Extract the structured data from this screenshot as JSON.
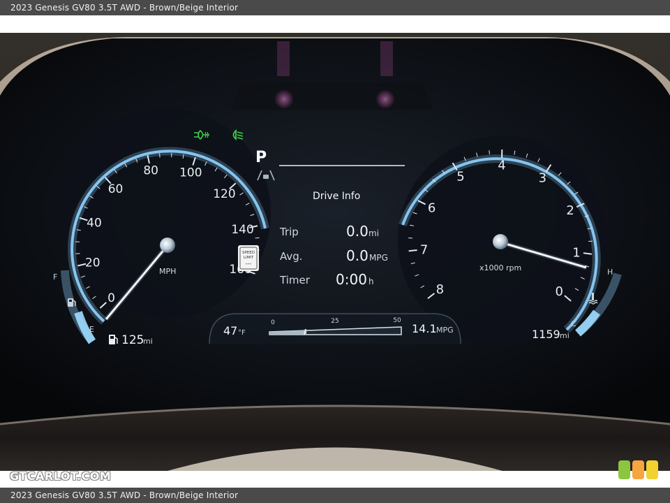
{
  "caption": "2023 Genesis GV80 3.5T AWD - Brown/Beige Interior",
  "watermark": "GTCARLOT.COM",
  "speedometer": {
    "ticks": [
      "0",
      "20",
      "40",
      "60",
      "80",
      "100",
      "120",
      "140",
      "160"
    ],
    "unit": "MPH",
    "range_value": "125",
    "range_unit": "mi",
    "fuel_full": "F",
    "fuel_empty": "E"
  },
  "tachometer": {
    "ticks": [
      "0",
      "1",
      "2",
      "3",
      "4",
      "5",
      "6",
      "7",
      "8"
    ],
    "unit": "x1000 rpm",
    "odometer_value": "1159",
    "odometer_unit": "mi",
    "temp_hot": "H",
    "temp_cold": "C"
  },
  "gear": "P",
  "drive_info": {
    "title": "Drive Info",
    "rows": [
      {
        "label": "Trip",
        "value": "0.0",
        "unit": "mi"
      },
      {
        "label": "Avg.",
        "value": "0.0",
        "unit": "MPG"
      },
      {
        "label": "Timer",
        "value": "0:00",
        "unit": "h"
      }
    ]
  },
  "speed_limit_sign": {
    "line1": "SPEED",
    "line2": "LIMIT",
    "line3": "---"
  },
  "outside_temp": {
    "value": "47",
    "unit": "°F"
  },
  "mpg_gauge": {
    "scale": [
      "0",
      "25",
      "50"
    ],
    "value": "14.1",
    "unit": "MPG",
    "level": 14.1
  },
  "indicator_colors": {
    "beam": "#3cd24a",
    "cluster_blue": "#8fd4ff",
    "pink": "#ff6fd8"
  },
  "logo_colors": [
    "#8cc63f",
    "#f7a541",
    "#f2d22e"
  ]
}
